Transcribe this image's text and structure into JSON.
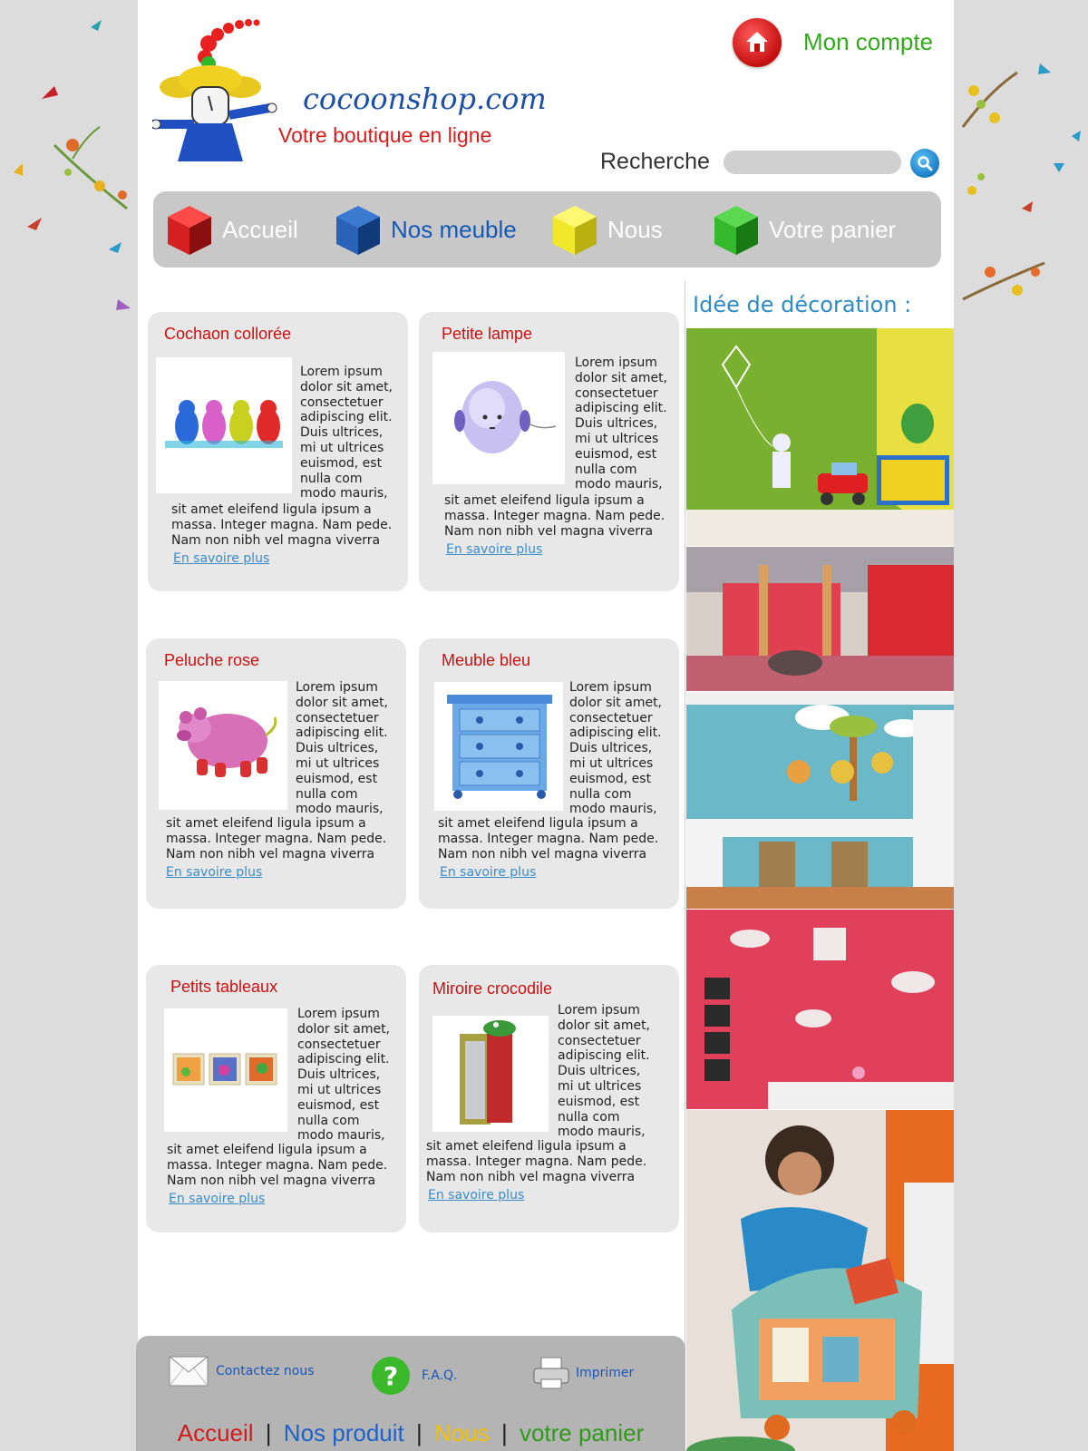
{
  "header": {
    "brand": "cocoonshop.com",
    "tagline": "Votre boutique en ligne",
    "account_label": "Mon compte",
    "search_label": "Recherche",
    "search_value": ""
  },
  "nav": [
    {
      "label": "Accueil",
      "color": "#ffffff",
      "cube": "#d42020"
    },
    {
      "label": "Nos meuble",
      "color": "#1458b8",
      "cube": "#1f5cb0"
    },
    {
      "label": "Nous",
      "color": "#ffffff",
      "cube": "#e8e020"
    },
    {
      "label": "Votre panier",
      "color": "#ffffff",
      "cube": "#2fb82a"
    }
  ],
  "products": [
    {
      "title": "Cochaon collorée",
      "text_side": "Lorem ipsum dolor sit amet, consectetuer adipiscing elit. Duis ultrices, mi ut ultrices euismod, est nulla com modo mauris,",
      "text_bottom": "sit amet eleifend ligula ipsum a massa. Integer magna. Nam pede. Nam non nibh vel magna viverra",
      "link": "En savoire plus"
    },
    {
      "title": "Petite lampe",
      "text_side": "Lorem ipsum dolor sit amet, consectetuer adipiscing elit. Duis ultrices, mi ut ultrices euismod, est nulla com modo mauris,",
      "text_bottom": "sit amet eleifend ligula ipsum a massa. Integer magna. Nam pede. Nam non nibh vel magna viverra",
      "link": "En savoire plus"
    },
    {
      "title": "Peluche rose",
      "text_side": "Lorem ipsum dolor sit amet, consectetuer adipiscing elit. Duis ultrices, mi ut ultrices euismod, est nulla com modo mauris,",
      "text_bottom": "sit amet eleifend ligula ipsum a massa. Integer magna. Nam pede. Nam non nibh vel magna viverra",
      "link": "En savoire plus"
    },
    {
      "title": "Meuble bleu",
      "text_side": "Lorem ipsum dolor sit amet, consectetuer adipiscing elit. Duis ultrices, mi ut ultrices euismod, est nulla com modo mauris,",
      "text_bottom": "sit amet eleifend ligula ipsum a massa. Integer magna. Nam pede. Nam non nibh vel magna viverra",
      "link": "En savoire plus"
    },
    {
      "title": "Petits tableaux",
      "text_side": "Lorem ipsum dolor sit amet, consectetuer adipiscing elit. Duis ultrices, mi ut ultrices euismod, est nulla com modo mauris,",
      "text_bottom": "sit amet eleifend ligula ipsum a massa. Integer magna. Nam pede. Nam non nibh vel magna viverra",
      "link": "En savoire plus"
    },
    {
      "title": "Miroire crocodile",
      "text_side": "Lorem ipsum dolor sit amet, consectetuer adipiscing elit. Duis ultrices, mi ut ultrices euismod, est nulla com modo mauris,",
      "text_bottom": "sit amet eleifend ligula ipsum a massa. Integer magna. Nam pede. Nam non nibh vel magna viverra",
      "link": "En savoire plus"
    }
  ],
  "sidebar": {
    "title": "Idée de décoration :"
  },
  "footer": {
    "contact_label": "Contactez nous",
    "faq_label": "F.A.Q.",
    "print_label": "Imprimer",
    "links": [
      {
        "label": "Accueil",
        "color": "#d41a1a"
      },
      {
        "label": "Nos produit",
        "color": "#1f62c8"
      },
      {
        "label": "Nous",
        "color": "#f0c000"
      },
      {
        "label": "votre panier",
        "color": "#2f9a1a"
      }
    ],
    "separator": "|"
  }
}
